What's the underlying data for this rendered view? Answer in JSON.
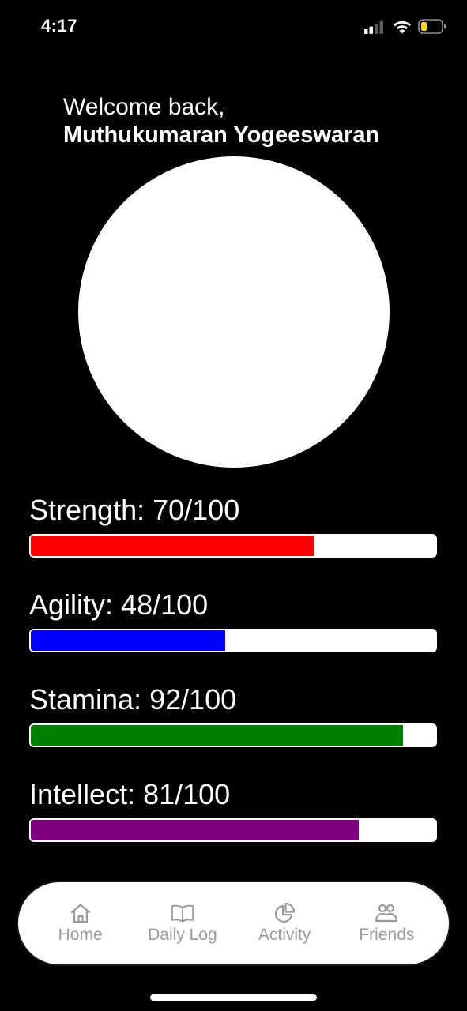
{
  "status_bar": {
    "time": "4:17",
    "signal_icon": "cellular-signal-icon",
    "wifi_icon": "wifi-icon",
    "battery_icon": "battery-low-icon",
    "battery_color": "#FFD60A"
  },
  "greeting": {
    "line": "Welcome back,",
    "name": "Muthukumaran Yogeeswaran"
  },
  "stats": [
    {
      "name": "Strength:",
      "value_text": "70/100",
      "value": 70,
      "max": 100,
      "color": "#FF0000"
    },
    {
      "name": "Agility:",
      "value_text": "48/100",
      "value": 48,
      "max": 100,
      "color": "#0000FF"
    },
    {
      "name": "Stamina:",
      "value_text": "92/100",
      "value": 92,
      "max": 100,
      "color": "#008000"
    },
    {
      "name": "Intellect:",
      "value_text": "81/100",
      "value": 81,
      "max": 100,
      "color": "#800080"
    }
  ],
  "nav": {
    "items": [
      {
        "label": "Home",
        "icon": "home-icon"
      },
      {
        "label": "Daily Log",
        "icon": "book-icon"
      },
      {
        "label": "Activity",
        "icon": "pie-chart-icon"
      },
      {
        "label": "Friends",
        "icon": "people-icon"
      }
    ]
  }
}
